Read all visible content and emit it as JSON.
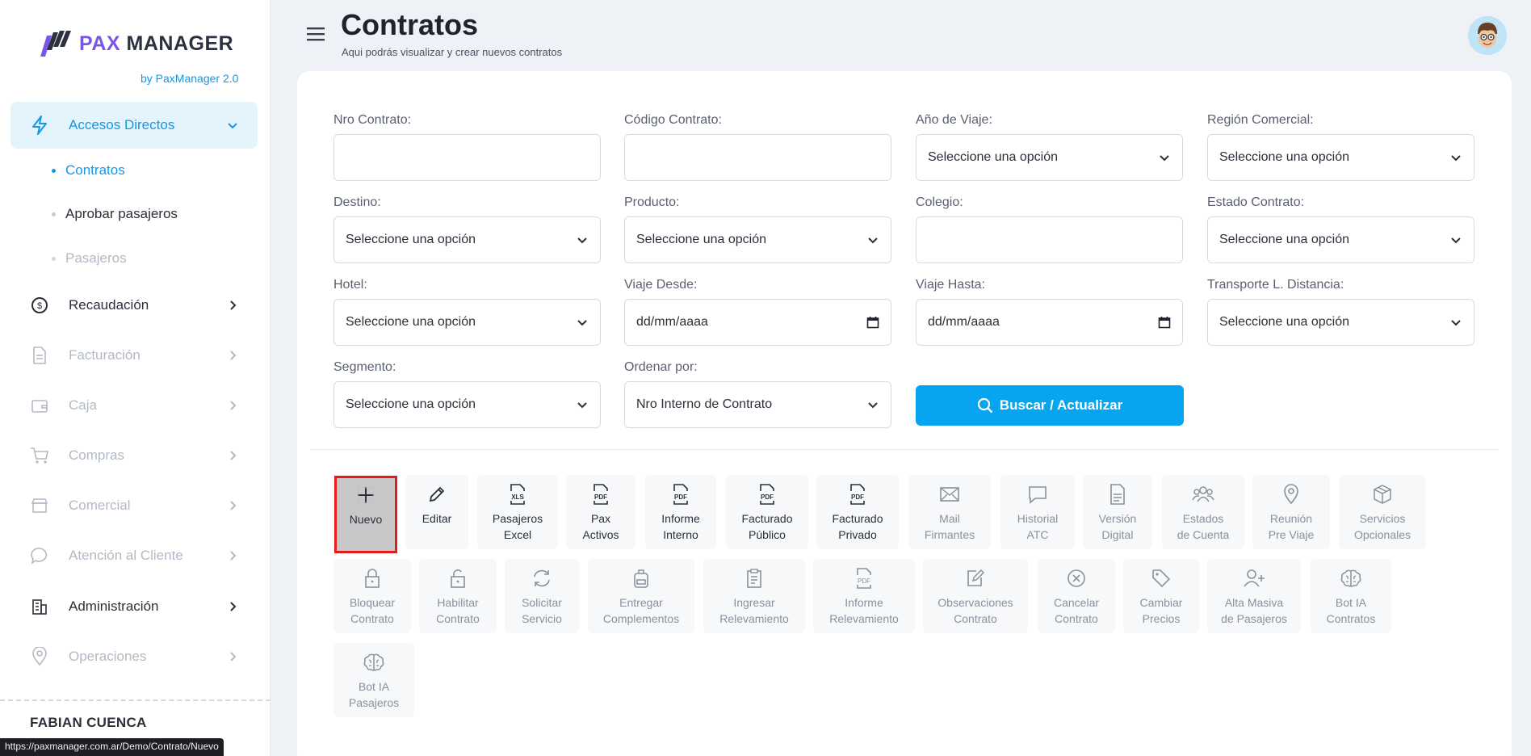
{
  "brand": {
    "pax": "PAX",
    "manager": "MANAGER",
    "sub": "by PaxManager 2.0"
  },
  "sidebar": {
    "items": [
      {
        "label": "Accesos Directos",
        "icon": "bolt-icon"
      },
      {
        "label": "Recaudación",
        "icon": "dollar-coin-icon"
      },
      {
        "label": "Facturación",
        "icon": "document-icon"
      },
      {
        "label": "Caja",
        "icon": "wallet-icon"
      },
      {
        "label": "Compras",
        "icon": "cart-icon"
      },
      {
        "label": "Comercial",
        "icon": "store-icon"
      },
      {
        "label": "Atención al Cliente",
        "icon": "chat-icon"
      },
      {
        "label": "Administración",
        "icon": "building-icon"
      },
      {
        "label": "Operaciones",
        "icon": "location-pin-icon"
      }
    ],
    "subitems": [
      "Contratos",
      "Aprobar pasajeros",
      "Pasajeros"
    ],
    "user_name": "FABIAN CUENCA"
  },
  "status_url": "https://paxmanager.com.ar/Demo/Contrato/Nuevo",
  "header": {
    "title": "Contratos",
    "subtitle": "Aqui podrás visualizar y crear nuevos contratos"
  },
  "filters": {
    "nro_contrato": {
      "label": "Nro Contrato:",
      "value": ""
    },
    "codigo_contrato": {
      "label": "Código Contrato:",
      "value": ""
    },
    "anio_viaje": {
      "label": "Año de Viaje:",
      "value": "Seleccione una opción"
    },
    "region_comercial": {
      "label": "Región Comercial:",
      "value": "Seleccione una opción"
    },
    "destino": {
      "label": "Destino:",
      "value": "Seleccione una opción"
    },
    "producto": {
      "label": "Producto:",
      "value": "Seleccione una opción"
    },
    "colegio": {
      "label": "Colegio:",
      "value": ""
    },
    "estado_contrato": {
      "label": "Estado Contrato:",
      "value": "Seleccione una opción"
    },
    "hotel": {
      "label": "Hotel:",
      "value": "Seleccione una opción"
    },
    "viaje_desde": {
      "label": "Viaje Desde:",
      "value": "dd/mm/aaaa"
    },
    "viaje_hasta": {
      "label": "Viaje Hasta:",
      "value": "dd/mm/aaaa"
    },
    "transporte": {
      "label": "Transporte L. Distancia:",
      "value": "Seleccione una opción"
    },
    "segmento": {
      "label": "Segmento:",
      "value": "Seleccione una opción"
    },
    "ordenar_por": {
      "label": "Ordenar por:",
      "value": "Nro Interno de Contrato"
    }
  },
  "search_button": "Buscar / Actualizar",
  "actions": [
    {
      "l1": "Nuevo",
      "l2": ""
    },
    {
      "l1": "Editar",
      "l2": ""
    },
    {
      "l1": "Pasajeros",
      "l2": "Excel"
    },
    {
      "l1": "Pax",
      "l2": "Activos"
    },
    {
      "l1": "Informe",
      "l2": "Interno"
    },
    {
      "l1": "Facturado",
      "l2": "Público"
    },
    {
      "l1": "Facturado",
      "l2": "Privado"
    },
    {
      "l1": "Mail",
      "l2": "Firmantes"
    },
    {
      "l1": "Historial",
      "l2": "ATC"
    },
    {
      "l1": "Versión",
      "l2": "Digital"
    },
    {
      "l1": "Estados",
      "l2": "de Cuenta"
    },
    {
      "l1": "Reunión",
      "l2": "Pre Viaje"
    },
    {
      "l1": "Servicios",
      "l2": "Opcionales"
    },
    {
      "l1": "Bloquear",
      "l2": "Contrato"
    },
    {
      "l1": "Habilitar",
      "l2": "Contrato"
    },
    {
      "l1": "Solicitar",
      "l2": "Servicio"
    },
    {
      "l1": "Entregar",
      "l2": "Complementos"
    },
    {
      "l1": "Ingresar",
      "l2": "Relevamiento"
    },
    {
      "l1": "Informe",
      "l2": "Relevamiento"
    },
    {
      "l1": "Observaciones",
      "l2": "Contrato"
    },
    {
      "l1": "Cancelar",
      "l2": "Contrato"
    },
    {
      "l1": "Cambiar",
      "l2": "Precios"
    },
    {
      "l1": "Alta Masiva",
      "l2": "de Pasajeros"
    },
    {
      "l1": "Bot IA",
      "l2": "Contratos"
    },
    {
      "l1": "Bot IA",
      "l2": "Pasajeros"
    }
  ],
  "pdf_tag": "PDF",
  "xls_tag": "XLS",
  "colors": {
    "accent": "#07a5ef",
    "brand_purple": "#7b55e6",
    "selected_border": "#e01c1c"
  }
}
